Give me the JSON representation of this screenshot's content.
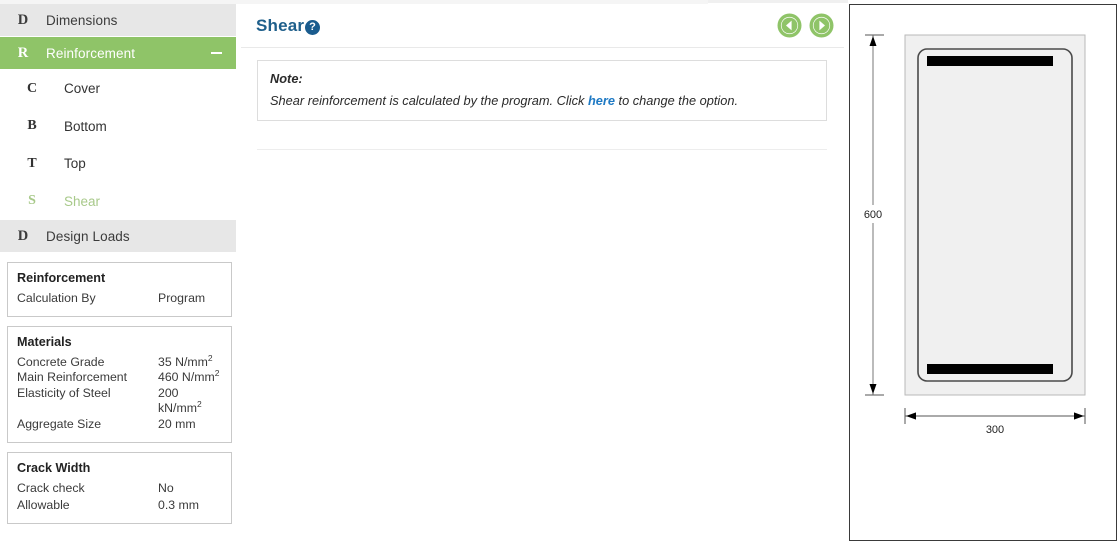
{
  "sidebar": {
    "groups": [
      {
        "letter": "D",
        "label": "Dimensions",
        "active": false,
        "collapse_icon": "minus-icon"
      },
      {
        "letter": "R",
        "label": "Reinforcement",
        "active": true,
        "collapse_icon": "minus-icon"
      }
    ],
    "sub_items": [
      {
        "letter": "C",
        "label": "Cover",
        "selected": false
      },
      {
        "letter": "B",
        "label": "Bottom",
        "selected": false
      },
      {
        "letter": "T",
        "label": "Top",
        "selected": false
      },
      {
        "letter": "S",
        "label": "Shear",
        "selected": true
      }
    ],
    "design_loads": {
      "letter": "D",
      "label": "Design Loads"
    },
    "cards": [
      {
        "title": "Reinforcement",
        "rows": [
          {
            "key": "Calculation By",
            "value": "Program"
          }
        ]
      },
      {
        "title": "Materials",
        "rows": [
          {
            "key": "Concrete Grade",
            "value": "35 N/mm",
            "sup": "2"
          },
          {
            "key": "Main Reinforcement",
            "value": "460 N/mm",
            "sup": "2"
          },
          {
            "key": "Elasticity of Steel",
            "value": "200 kN/mm",
            "sup": "2"
          },
          {
            "key": "Aggregate Size",
            "value": "20 mm",
            "sup": ""
          }
        ]
      },
      {
        "title": "Crack Width",
        "rows": [
          {
            "key": "Crack check",
            "value": "No"
          },
          {
            "key": "Allowable",
            "value": "0.3 mm"
          }
        ]
      }
    ]
  },
  "main": {
    "title": "Shear",
    "help_icon_glyph": "?",
    "prev_button": "previous-arrow",
    "next_button": "next-arrow",
    "note": {
      "label": "Note:",
      "text_before": "Shear reinforcement is calculated by the program. Click ",
      "link_text": "here",
      "text_after": " to change the option."
    }
  },
  "diagram": {
    "type": "beam-cross-section",
    "height_label": "600",
    "width_label": "300",
    "units": "mm"
  },
  "colors": {
    "accent_green": "#8fc468",
    "selected_green": "#a8c98a",
    "title_blue": "#1f5f8b",
    "link_blue": "#1f7ac4",
    "header_gray": "#e7e7e7"
  }
}
